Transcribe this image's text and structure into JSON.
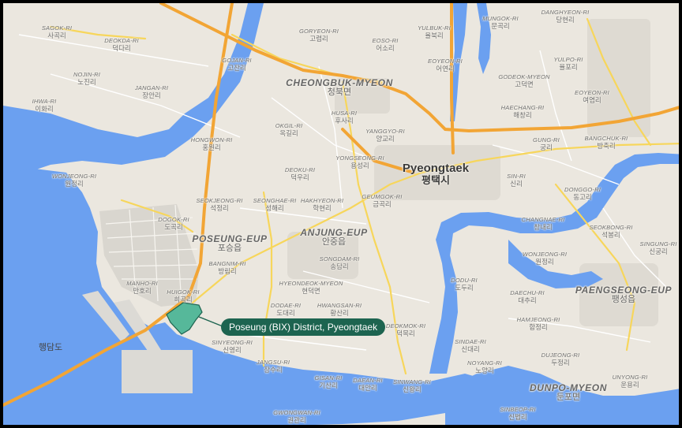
{
  "map": {
    "callout": "Poseung (BIX) District, Pyeongtaek",
    "highlight_color": "#56b89a",
    "callout_color": "#1d6450",
    "water_color": "#6ba0f0",
    "land_color": "#ebe7df",
    "highway_color": "#f2a535",
    "city": {
      "en": "Pyeongtaek",
      "ko": "평택시"
    },
    "regions": [
      {
        "en": "CHEONGBUK-MYEON",
        "ko": "청북면"
      },
      {
        "en": "POSEUNG-EUP",
        "ko": "포승읍"
      },
      {
        "en": "ANJUNG-EUP",
        "ko": "안중읍"
      },
      {
        "en": "PAENGSEONG-EUP",
        "ko": "팽성읍"
      },
      {
        "en": "DUNPO-MYEON",
        "ko": "둔포면"
      }
    ],
    "water_labels": [
      {
        "ko": "행담도"
      }
    ],
    "villages": [
      {
        "en": "SAGOK-RI",
        "ko": "사곡리"
      },
      {
        "en": "DEOKDA-RI",
        "ko": "덕다리"
      },
      {
        "en": "NOJIN-RI",
        "ko": "노진리"
      },
      {
        "en": "JANGAN-RI",
        "ko": "장안리"
      },
      {
        "en": "IHWA-RI",
        "ko": "이화리"
      },
      {
        "en": "GOJAN-RI",
        "ko": "고잔리"
      },
      {
        "en": "GORYEON-RI",
        "ko": "고렴리"
      },
      {
        "en": "EOSO-RI",
        "ko": "어소리"
      },
      {
        "en": "YULBUK-RI",
        "ko": "율북리"
      },
      {
        "en": "EOYEON-RI",
        "ko": "어연리"
      },
      {
        "en": "MUNGOK-RI",
        "ko": "문곡리"
      },
      {
        "en": "DANGHYEON-RI",
        "ko": "당현리"
      },
      {
        "en": "YULPO-RI",
        "ko": "율포리"
      },
      {
        "en": "GODEOK-MYEON",
        "ko": "고덕면"
      },
      {
        "en": "EOYEON-RI",
        "ko": "여염리"
      },
      {
        "en": "HAECHANG-RI",
        "ko": "해창리"
      },
      {
        "en": "HUSA-RI",
        "ko": "후사리"
      },
      {
        "en": "OKGIL-RI",
        "ko": "옥길리"
      },
      {
        "en": "YANGGYO-RI",
        "ko": "양교리"
      },
      {
        "en": "HONGWON-RI",
        "ko": "홍원리"
      },
      {
        "en": "GUNG-RI",
        "ko": "궁리"
      },
      {
        "en": "BANGCHUK-RI",
        "ko": "방축리"
      },
      {
        "en": "YONGSEONG-RI",
        "ko": "용성리"
      },
      {
        "en": "WONJEONG-RI",
        "ko": "원정리"
      },
      {
        "en": "DEOKU-RI",
        "ko": "덕우리"
      },
      {
        "en": "SIN-RI",
        "ko": "신리"
      },
      {
        "en": "DONGGO-RI",
        "ko": "동고리"
      },
      {
        "en": "SEOKJEONG-RI",
        "ko": "석정리"
      },
      {
        "en": "SEONGHAE-RI",
        "ko": "성해리"
      },
      {
        "en": "HAKHYEON-RI",
        "ko": "학현리"
      },
      {
        "en": "GEUMGOK-RI",
        "ko": "금곡리"
      },
      {
        "en": "DOGOK-RI",
        "ko": "도곡리"
      },
      {
        "en": "CHANGNAE-RI",
        "ko": "창내리"
      },
      {
        "en": "SEOKBONG-RI",
        "ko": "석봉리"
      },
      {
        "en": "SINGUNG-RI",
        "ko": "신궁리"
      },
      {
        "en": "BANGNIM-RI",
        "ko": "방림리"
      },
      {
        "en": "SONGDAM-RI",
        "ko": "송담리"
      },
      {
        "en": "WONJEONG-RI",
        "ko": "원정리"
      },
      {
        "en": "MANHO-RI",
        "ko": "만호리"
      },
      {
        "en": "HYEONDEOK-MYEON",
        "ko": "현덕면"
      },
      {
        "en": "DODU-RI",
        "ko": "도두리"
      },
      {
        "en": "DAECHU-RI",
        "ko": "대추리"
      },
      {
        "en": "HUIGOK-RI",
        "ko": "희곡리"
      },
      {
        "en": "DODAE-RI",
        "ko": "도대리"
      },
      {
        "en": "HWANGSAN-RI",
        "ko": "황산리"
      },
      {
        "en": "HAMJEONG-RI",
        "ko": "함정리"
      },
      {
        "en": "DEOKMOK-RI",
        "ko": "덕목리"
      },
      {
        "en": "SINYEONG-RI",
        "ko": "신영리"
      },
      {
        "en": "SINDAE-RI",
        "ko": "신대리"
      },
      {
        "en": "DUJEONG-RI",
        "ko": "두정리"
      },
      {
        "en": "JANGSU-RI",
        "ko": "장수리"
      },
      {
        "en": "NOYANG-RI",
        "ko": "노양리"
      },
      {
        "en": "GISAN-RI",
        "ko": "기산리"
      },
      {
        "en": "DAEAN-RI",
        "ko": "대안리"
      },
      {
        "en": "SINWANG-RI",
        "ko": "신왕리"
      },
      {
        "en": "UNYONG-RI",
        "ko": "운용리"
      },
      {
        "en": "SINBEOP-RI",
        "ko": "신법리"
      },
      {
        "en": "GWONGWAN-RI",
        "ko": "권관리"
      }
    ]
  }
}
